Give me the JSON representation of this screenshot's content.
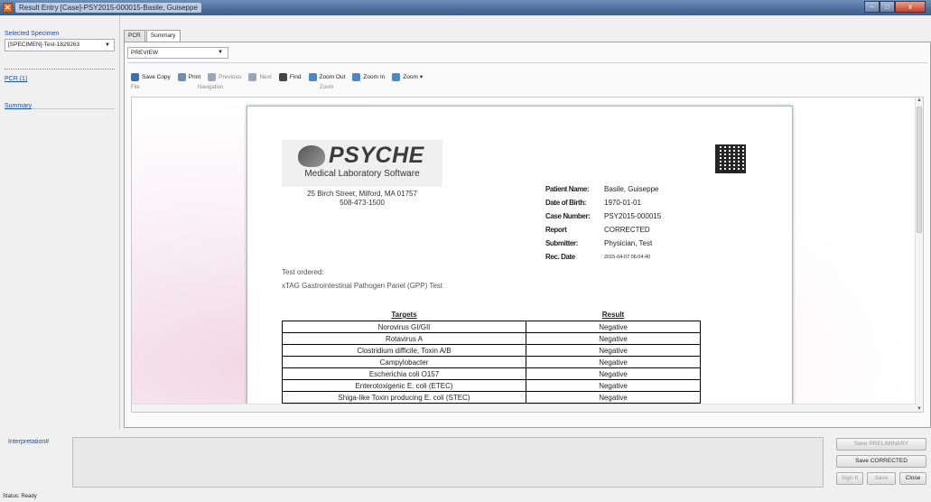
{
  "window": {
    "title": "Result Entry [Case]-PSY2015-000015-Basile, Guiseppe",
    "minimize": "–",
    "maximize": "□",
    "close": "x"
  },
  "left_panel": {
    "selected_label": "Selected Specimen",
    "specimen_value": "[SPECIMEN]-Test-1829263",
    "links": [
      "PCR (1)",
      "Summary"
    ]
  },
  "tabs": [
    "PCR",
    "Summary"
  ],
  "preview_select": "PREVIEW",
  "toolbar": {
    "buttons": [
      "Save Copy",
      "Print",
      "Previous",
      "Next",
      "Find",
      "Zoom Out",
      "Zoom In",
      "Zoom"
    ],
    "groups": [
      "File",
      "Navigation",
      "Zoom"
    ]
  },
  "report": {
    "brand": "PSYCHE",
    "subtitle": "Medical Laboratory Software",
    "address": "25 Birch Street, Milford, MA 01757",
    "phone": "508-473-1500",
    "patient": {
      "labels": [
        "Patient Name:",
        "Date of Birth:",
        "Case Number:",
        "Report",
        "Submitter:",
        "Rec. Date"
      ],
      "values": [
        "Basile, Guiseppe",
        "1970-01-01",
        "PSY2015-000015",
        "CORRECTED",
        "Physician, Test",
        "2015-04-07 06:04:40"
      ]
    },
    "test_ordered_label": "Test ordered:",
    "test_name": "xTAG Gastrointestinal Pathogen Panel (GPP) Test",
    "table": {
      "headers": [
        "Targets",
        "Result"
      ],
      "rows": [
        [
          "Norovirus GI/GII",
          "Negative"
        ],
        [
          "Rotavirus A",
          "Negative"
        ],
        [
          "Clostridium difficile, Toxin A/B",
          "Negative"
        ],
        [
          "Campylobacter",
          "Negative"
        ],
        [
          "Escherichia coli O157",
          "Negative"
        ],
        [
          "Enterotoxigenic E. coli (ETEC)",
          "Negative"
        ],
        [
          "Shiga-like Toxin producing E. coli (STEC)",
          "Negative"
        ]
      ]
    }
  },
  "bottom": {
    "interpretation_label": "Interpretation#",
    "buttons": {
      "save_preliminary": "Save PRELIMINARY",
      "save_corrected": "Save CORRECTED",
      "sign_it": "Sign It",
      "save": "Save",
      "close": "Close"
    }
  },
  "status": "Status: Ready"
}
